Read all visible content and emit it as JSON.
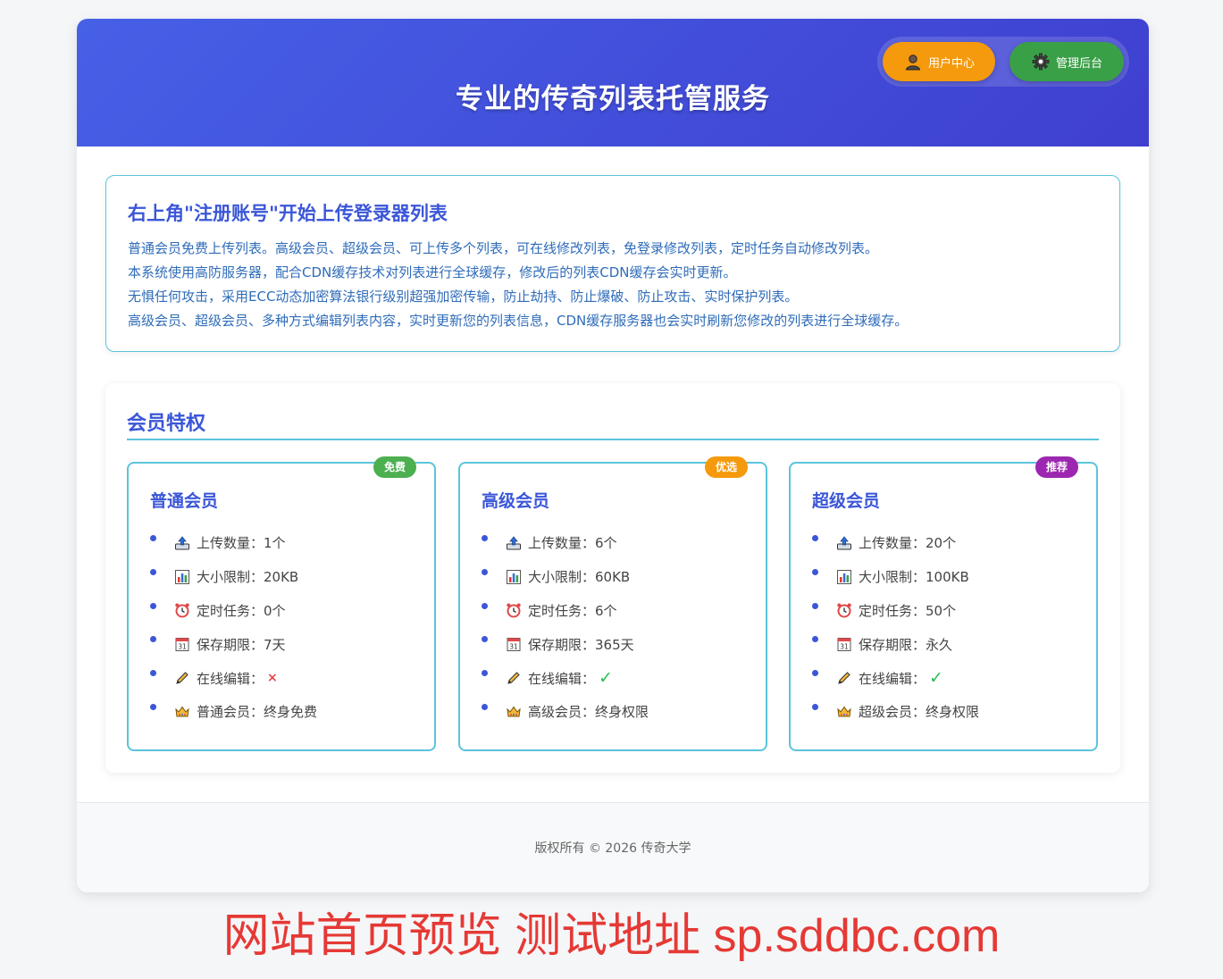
{
  "header": {
    "title": "专业的传奇列表托管服务",
    "user_center_label": "用户中心",
    "admin_label": "管理后台"
  },
  "notice": {
    "title": "右上角\"注册账号\"开始上传登录器列表",
    "lines": [
      "普通会员免费上传列表。高级会员、超级会员、可上传多个列表，可在线修改列表，免登录修改列表，定时任务自动修改列表。",
      "本系统使用高防服务器，配合CDN缓存技术对列表进行全球缓存，修改后的列表CDN缓存会实时更新。",
      "无惧任何攻击，采用ECC动态加密算法银行级别超强加密传输，防止劫持、防止爆破、防止攻击、实时保护列表。",
      "高级会员、超级会员、多种方式编辑列表内容，实时更新您的列表信息，CDN缓存服务器也会实时刷新您修改的列表进行全球缓存。"
    ]
  },
  "privileges": {
    "title": "会员特权",
    "tiers": [
      {
        "name": "普通会员",
        "badge": "免费",
        "badge_color": "#4caf50",
        "items": [
          {
            "icon": "upload-tray-icon",
            "text": "上传数量：1个"
          },
          {
            "icon": "bar-chart-icon",
            "text": "大小限制：20KB"
          },
          {
            "icon": "alarm-clock-icon",
            "text": "定时任务：0个"
          },
          {
            "icon": "calendar-icon",
            "text": "保存期限：7天"
          },
          {
            "icon": "pencil-icon",
            "text": "在线编辑：",
            "mark": "×"
          },
          {
            "icon": "crown-icon",
            "text": "普通会员：终身免费"
          }
        ]
      },
      {
        "name": "高级会员",
        "badge": "优选",
        "badge_color": "#f59a0c",
        "items": [
          {
            "icon": "upload-tray-icon",
            "text": "上传数量：6个"
          },
          {
            "icon": "bar-chart-icon",
            "text": "大小限制：60KB"
          },
          {
            "icon": "alarm-clock-icon",
            "text": "定时任务：6个"
          },
          {
            "icon": "calendar-icon",
            "text": "保存期限：365天"
          },
          {
            "icon": "pencil-icon",
            "text": "在线编辑：",
            "mark": "✓"
          },
          {
            "icon": "crown-icon",
            "text": "高级会员：终身权限"
          }
        ]
      },
      {
        "name": "超级会员",
        "badge": "推荐",
        "badge_color": "#9c27b0",
        "items": [
          {
            "icon": "upload-tray-icon",
            "text": "上传数量：20个"
          },
          {
            "icon": "bar-chart-icon",
            "text": "大小限制：100KB"
          },
          {
            "icon": "alarm-clock-icon",
            "text": "定时任务：50个"
          },
          {
            "icon": "calendar-icon",
            "text": "保存期限：永久"
          },
          {
            "icon": "pencil-icon",
            "text": "在线编辑：",
            "mark": "✓"
          },
          {
            "icon": "crown-icon",
            "text": "超级会员：终身权限"
          }
        ]
      }
    ]
  },
  "footer": {
    "copyright": "版权所有 © 2026 传奇大学"
  },
  "preview_banner": "网站首页预览  测试地址 sp.sddbc.com",
  "colors": {
    "header_gradient_start": "#4660e6",
    "header_gradient_end": "#3f3fcf",
    "accent_blue": "#3b56d8",
    "border_cyan": "#5bc4dc",
    "banner_red": "#e53935"
  }
}
